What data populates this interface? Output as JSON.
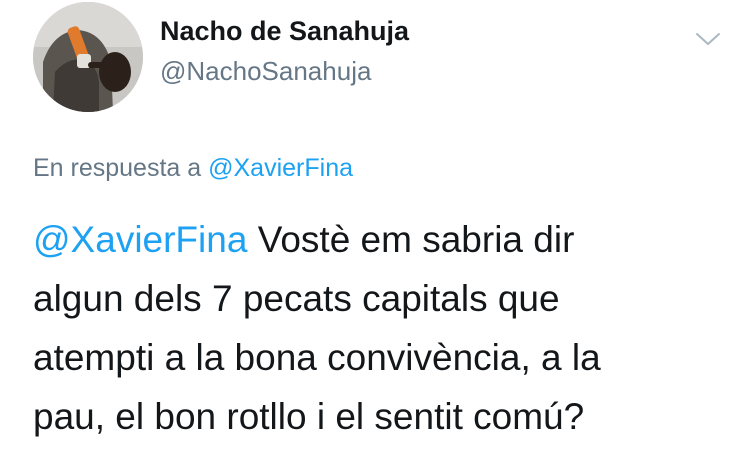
{
  "author": {
    "display_name": "Nacho de Sanahuja",
    "handle": "@NachoSanahuja",
    "avatar_icon": "user-avatar-photo"
  },
  "menu": {
    "icon": "chevron-down-icon"
  },
  "reply_context": {
    "prefix": "En respuesta a",
    "mention": "@XavierFina"
  },
  "tweet": {
    "mention": "@XavierFina",
    "lines": [
      " Vostè em sabria dir",
      "algun dels 7 pecats capitals que",
      "atempti a la bona convivència, a la",
      "pau, el bon rotllo i el sentit comú?"
    ]
  },
  "colors": {
    "text": "#14171a",
    "secondary": "#657786",
    "link": "#1da1f2"
  }
}
